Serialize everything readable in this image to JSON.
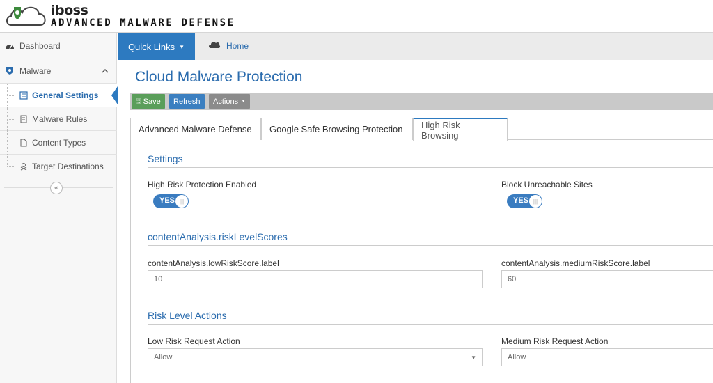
{
  "brand": {
    "name": "iboss",
    "subtitle": "ADVANCED MALWARE DEFENSE"
  },
  "sidebar": {
    "items": [
      {
        "label": "Dashboard",
        "icon": "dashboard-icon"
      },
      {
        "label": "Malware",
        "icon": "shield-icon"
      }
    ],
    "subitems": [
      {
        "label": "General Settings",
        "icon": "settings-icon",
        "active": true
      },
      {
        "label": "Malware Rules",
        "icon": "document-icon"
      },
      {
        "label": "Content Types",
        "icon": "file-icon"
      },
      {
        "label": "Target Destinations",
        "icon": "target-icon"
      }
    ],
    "collapse_symbol": "«"
  },
  "navbar": {
    "quick_links": "Quick Links",
    "home": "Home"
  },
  "page": {
    "title": "Cloud Malware Protection"
  },
  "toolbar": {
    "save": "Save",
    "refresh": "Refresh",
    "actions": "Actions"
  },
  "tabs": [
    {
      "label": "Advanced Malware Defense"
    },
    {
      "label": "Google Safe Browsing Protection"
    },
    {
      "label": "High Risk Browsing",
      "active": true
    }
  ],
  "settings": {
    "title": "Settings",
    "high_risk_label": "High Risk Protection Enabled",
    "high_risk_value": "YES",
    "block_unreachable_label": "Block Unreachable Sites",
    "block_unreachable_value": "YES"
  },
  "risk_scores": {
    "title": "contentAnalysis.riskLevelScores",
    "low_label": "contentAnalysis.lowRiskScore.label",
    "low_value": "10",
    "medium_label": "contentAnalysis.mediumRiskScore.label",
    "medium_value": "60"
  },
  "risk_actions": {
    "title": "Risk Level Actions",
    "low_label": "Low Risk Request Action",
    "low_value": "Allow",
    "medium_label": "Medium Risk Request Action",
    "medium_value": "Allow"
  },
  "colors": {
    "accent": "#2d7ac0",
    "save": "#5a9e5a",
    "toolbar": "#c9c9c9"
  }
}
